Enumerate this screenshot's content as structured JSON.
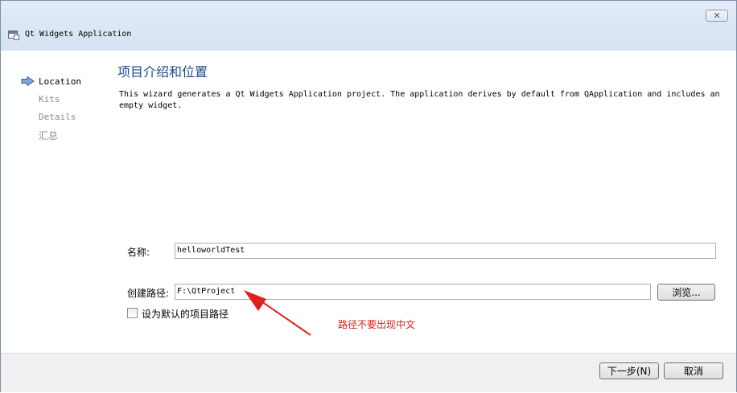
{
  "window": {
    "title": "Qt Widgets Application",
    "close_glyph": "✕"
  },
  "steps": [
    {
      "label": "Location",
      "active": true
    },
    {
      "label": "Kits",
      "active": false
    },
    {
      "label": "Details",
      "active": false
    },
    {
      "label": "汇总",
      "active": false
    }
  ],
  "page": {
    "heading": "项目介绍和位置",
    "description": "This wizard generates a Qt Widgets Application project. The application derives by default from QApplication and includes an empty widget."
  },
  "form": {
    "name_label": "名称:",
    "name_value": "helloworldTest",
    "path_label": "创建路径:",
    "path_value": "F:\\QtProject",
    "browse_label": "浏览...",
    "default_checkbox_label": "设为默认的项目路径",
    "default_checked": false
  },
  "annotation": {
    "text": "路径不要出现中文",
    "color": "#e02020"
  },
  "footer": {
    "next_label": "下一步(N)",
    "cancel_label": "取消"
  },
  "icons": {
    "active_step": "arrow-right-icon",
    "app": "window-icon"
  },
  "colors": {
    "heading": "#1f4a8a",
    "active_step_text": "#000000",
    "inactive_step_text": "#8a8a8a"
  }
}
